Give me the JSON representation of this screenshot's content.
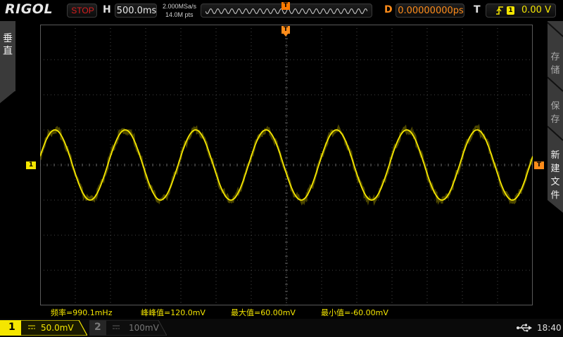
{
  "brand": "RIGOL",
  "run_state": "STOP",
  "horizontal": {
    "label": "H",
    "timebase": "500.0ms"
  },
  "acquisition": {
    "sample_rate": "2.000MSa/s",
    "memory_depth": "14.0M pts"
  },
  "trigger_position_marker": "T",
  "delay": {
    "label": "D",
    "value": "0.00000000ps"
  },
  "trigger": {
    "label": "T",
    "source_channel": "1",
    "level": "0.00 V"
  },
  "left_menu": {
    "label": "垂直"
  },
  "right_menu": {
    "items": [
      "存储",
      "保存",
      "新建文件"
    ]
  },
  "markers": {
    "channel1": "1",
    "trigger": "T"
  },
  "measurements": {
    "frequency": "频率=990.1mHz",
    "peak_to_peak": "峰峰值=120.0mV",
    "maximum": "最大值=60.00mV",
    "minimum": "最小值=-60.00mV"
  },
  "channels": [
    {
      "number": "1",
      "scale": "50.0mV",
      "active": true
    },
    {
      "number": "2",
      "scale": "100mV",
      "active": false
    }
  ],
  "clock": "18:40",
  "colors": {
    "ch1": "#f5e600",
    "trigger": "#ff8c1a",
    "stop": "#d81e1e",
    "grid": "#5a5a5a"
  },
  "icons": [
    "rising-edge-icon",
    "usb-icon",
    "dc-coupling-icon"
  ]
}
